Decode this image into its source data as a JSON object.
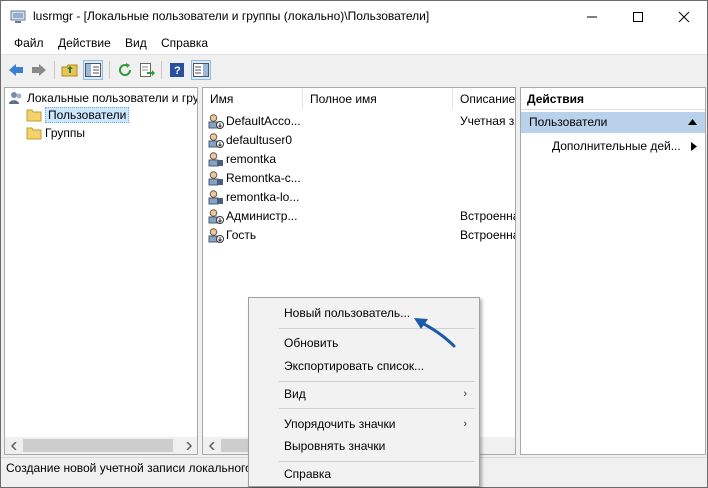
{
  "window": {
    "title": "lusrmgr - [Локальные пользователи и группы (локально)\\Пользователи]"
  },
  "menu": [
    "Файл",
    "Действие",
    "Вид",
    "Справка"
  ],
  "toolbar": {
    "icons": [
      "back-arrow-icon",
      "forward-arrow-icon",
      "up-folder-icon",
      "show-tree-icon",
      "refresh-icon",
      "export-icon",
      "help-icon",
      "action-pane-icon"
    ]
  },
  "tree": {
    "root": "Локальные пользователи и гру",
    "items": [
      "Пользователи",
      "Группы"
    ]
  },
  "list": {
    "columns": [
      "Имя",
      "Полное имя",
      "Описание"
    ],
    "rows": [
      {
        "name": "DefaultAcco...",
        "desc": "Учетная з"
      },
      {
        "name": "defaultuser0",
        "desc": ""
      },
      {
        "name": "remontka",
        "desc": ""
      },
      {
        "name": "Remontka-c...",
        "desc": ""
      },
      {
        "name": "remontka-lo...",
        "desc": ""
      },
      {
        "name": "Администр...",
        "desc": "Встроенна"
      },
      {
        "name": "Гость",
        "desc": "Встроенна"
      }
    ]
  },
  "actions": {
    "title": "Действия",
    "section": "Пользователи",
    "more": "Дополнительные дей..."
  },
  "status": "Создание новой учетной записи локального",
  "context_menu": {
    "new_user": "Новый пользователь...",
    "refresh": "Обновить",
    "export": "Экспортировать список...",
    "view": "Вид",
    "arrange": "Упорядочить значки",
    "align": "Выровнять значки",
    "help": "Справка"
  },
  "colors": {
    "selection": "#cce8ff",
    "action_section": "#b9d1ea",
    "annotation_arrow": "#1a5aa8"
  }
}
